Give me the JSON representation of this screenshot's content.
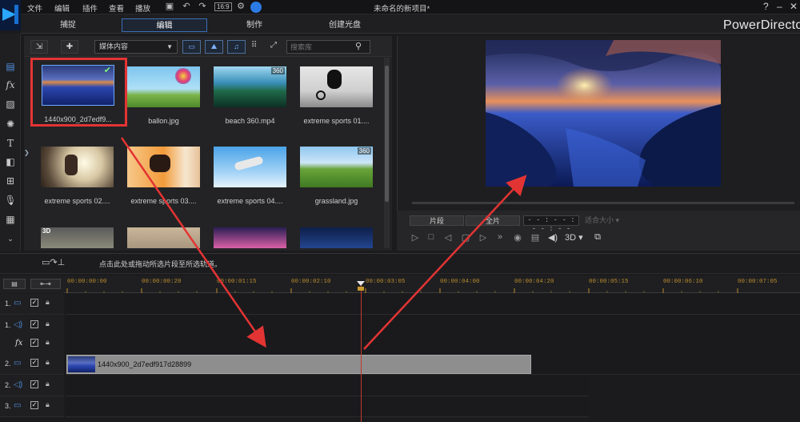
{
  "app": {
    "window_title": "未命名的新项目*",
    "brand": "PowerDirecto",
    "menu": [
      "文件",
      "编辑",
      "插件",
      "查看",
      "播放"
    ],
    "ratio": "16:9"
  },
  "tabs": [
    {
      "label": "捕捉"
    },
    {
      "label": "编辑",
      "active": true
    },
    {
      "label": "制作"
    },
    {
      "label": "创建光盘"
    }
  ],
  "library": {
    "media_select": "媒体内容",
    "search_placeholder": "搜索库",
    "items": [
      {
        "label": "1440x900_2d7edf9...",
        "selected": true
      },
      {
        "label": "ballon.jpg"
      },
      {
        "label": "beach 360.mp4",
        "badge": "360"
      },
      {
        "label": "extreme sports 01...."
      },
      {
        "label": "extreme sports 02...."
      },
      {
        "label": "extreme sports 03...."
      },
      {
        "label": "extreme sports 04...."
      },
      {
        "label": "grassland.jpg",
        "badge": "360"
      },
      {
        "label": "",
        "badge3d": "3D"
      },
      {
        "label": ""
      },
      {
        "label": ""
      },
      {
        "label": ""
      }
    ]
  },
  "preview": {
    "clip_btn": "片段",
    "movie_btn": "全片",
    "timecode": "- - : - - : - - : - -",
    "zoom": "适合大小",
    "three_d": "3D"
  },
  "timeline": {
    "hint": "点击此处或拖动所选片段至所选轨道。",
    "ruler": [
      "00:00:00:00",
      "00:00:00:20",
      "00:00:01:15",
      "00:00:02:10",
      "00:00:03:05",
      "00:00:04:00",
      "00:00:04:20",
      "00:00:05:15",
      "00:00:06:10",
      "00:00:07:05"
    ],
    "tracks": [
      {
        "num": "1.",
        "type": "video"
      },
      {
        "num": "1.",
        "type": "audio"
      },
      {
        "num": "",
        "type": "fx"
      },
      {
        "num": "2.",
        "type": "video"
      },
      {
        "num": "2.",
        "type": "audio"
      },
      {
        "num": "3.",
        "type": "video"
      }
    ],
    "clip_label": "1440x900_2d7edf917d28899"
  },
  "colors": {
    "accent": "#3b6fb6",
    "selection": "#e33434",
    "playhead": "#c0392b",
    "ruler_text": "#b88b2c"
  }
}
